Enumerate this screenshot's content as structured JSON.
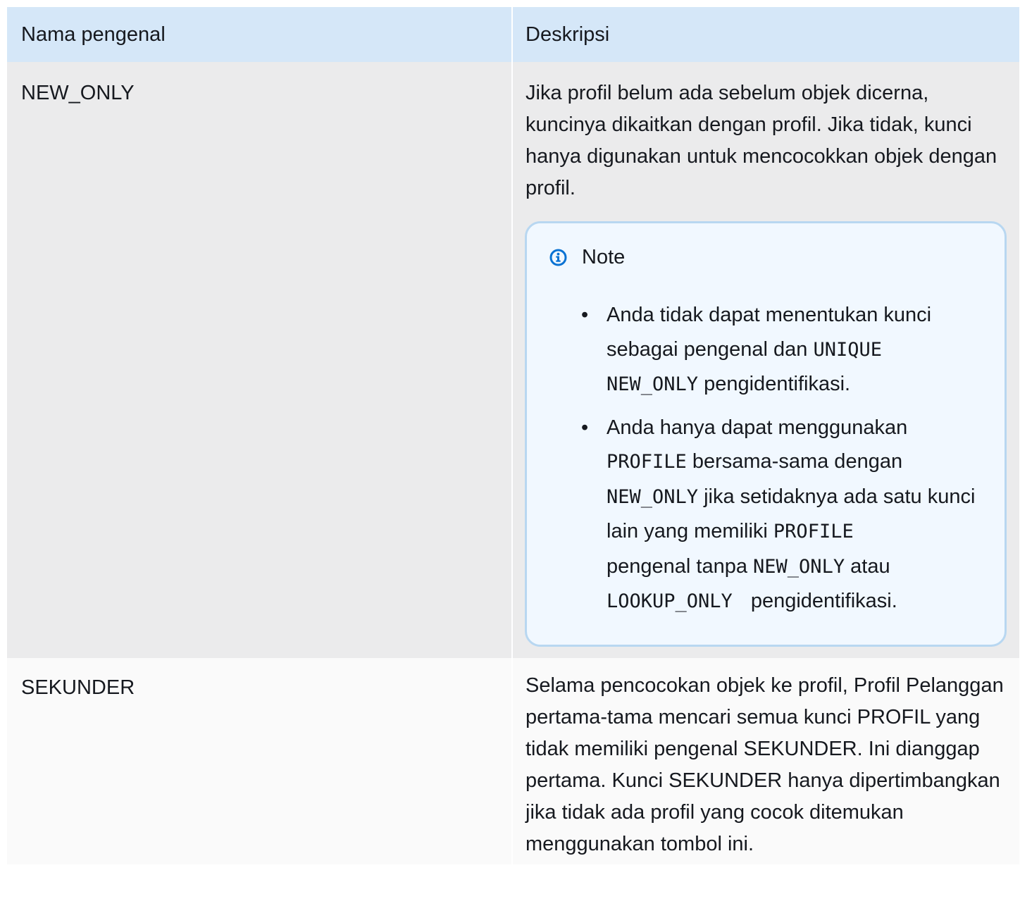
{
  "table": {
    "headers": {
      "name": "Nama pengenal",
      "description": "Deskripsi"
    },
    "rows": [
      {
        "name": "NEW_ONLY",
        "description": "Jika profil belum ada sebelum objek dicerna, kuncinya dikaitkan dengan profil. Jika tidak, kunci hanya digunakan untuk mencocokkan objek dengan profil.",
        "note": {
          "title": "Note",
          "icon": "info-icon",
          "items": [
            {
              "t1": "Anda tidak dapat menentukan kunci sebagai pengenal dan ",
              "c1": "UNIQUE",
              "c2": "NEW_ONLY",
              "t2": " pengidentifikasi."
            },
            {
              "t1": "Anda hanya dapat menggunakan ",
              "c1": "PROFILE",
              "t2": " bersama-sama dengan ",
              "c2": "NEW_ONLY",
              "t3": " jika setidaknya ada satu kunci lain yang memiliki ",
              "c3": "PROFILE",
              "t4": " pengenal tanpa ",
              "c4": "NEW_ONLY",
              "t5": " atau ",
              "c5": "LOOKUP_ONLY",
              "t6": "pengidentifikasi."
            }
          ]
        }
      },
      {
        "name": "SEKUNDER",
        "description": "Selama pencocokan objek ke profil, Profil Pelanggan pertama-tama mencari semua kunci PROFIL yang tidak memiliki pengenal SEKUNDER. Ini dianggap pertama. Kunci SEKUNDER hanya dipertimbangkan jika tidak ada profil yang cocok ditemukan menggunakan tombol ini."
      }
    ]
  }
}
